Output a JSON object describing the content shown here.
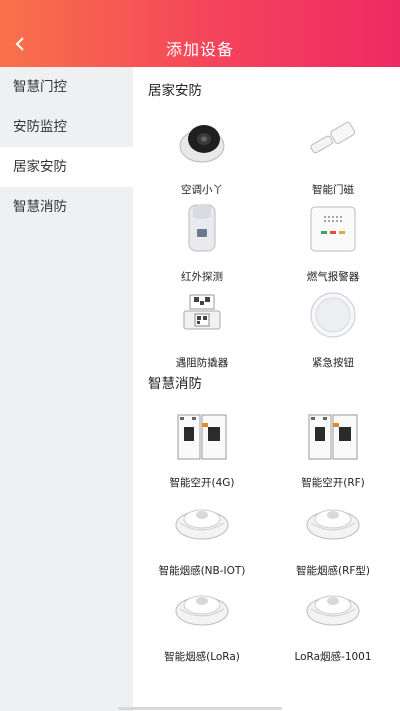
{
  "header": {
    "title": "添加设备",
    "back_icon": "chevron-left-icon"
  },
  "sidebar": {
    "items": [
      {
        "label": "智慧门控",
        "active": false
      },
      {
        "label": "安防监控",
        "active": false
      },
      {
        "label": "居家安防",
        "active": true
      },
      {
        "label": "智慧消防",
        "active": false
      }
    ]
  },
  "sections": [
    {
      "title": "居家安防",
      "devices": [
        {
          "label": "空调小丫",
          "icon": "ac-controller-icon"
        },
        {
          "label": "智能门磁",
          "icon": "door-sensor-icon"
        },
        {
          "label": "红外探测",
          "icon": "infrared-detector-icon"
        },
        {
          "label": "燃气报警器",
          "icon": "gas-alarm-icon"
        },
        {
          "label": "遇阻防撬器",
          "icon": "anti-pry-sensor-icon"
        },
        {
          "label": "紧急按钮",
          "icon": "emergency-button-icon"
        }
      ]
    },
    {
      "title": "智慧消防",
      "devices": [
        {
          "label": "智能空开(4G)",
          "icon": "circuit-breaker-icon"
        },
        {
          "label": "智能空开(RF)",
          "icon": "circuit-breaker-icon"
        },
        {
          "label": "智能烟感(NB-IOT)",
          "icon": "smoke-detector-icon"
        },
        {
          "label": "智能烟感(RF型)",
          "icon": "smoke-detector-icon"
        },
        {
          "label": "智能烟感(LoRa)",
          "icon": "smoke-detector-icon"
        },
        {
          "label": "LoRa烟感-1001",
          "icon": "smoke-detector-icon"
        }
      ]
    }
  ],
  "colors": {
    "header_start": "#f9724a",
    "header_end": "#ee2a63",
    "sidebar_bg": "#eff0f2"
  }
}
